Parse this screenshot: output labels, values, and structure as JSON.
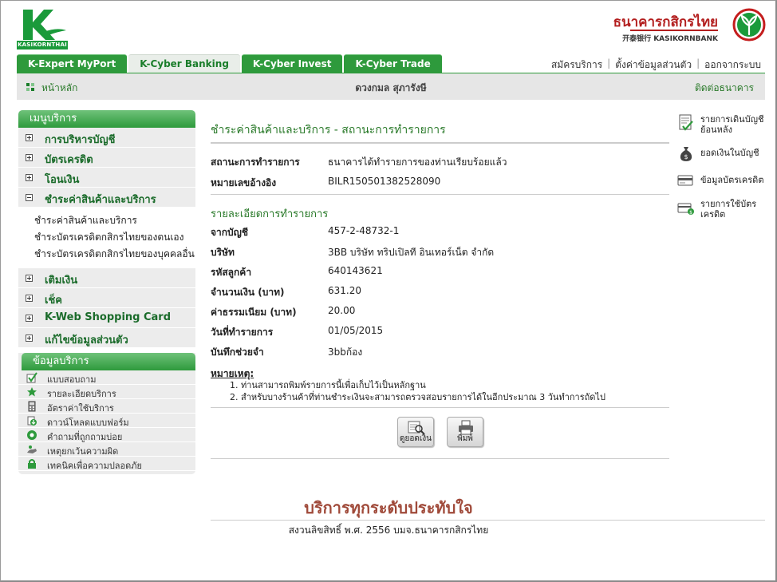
{
  "header": {
    "logo_text": "KASIKORNTHAI",
    "bank_name_th": "ธนาคารกสิกรไทย",
    "bank_name_en": "开泰银行 KASIKORNBANK"
  },
  "tabs": [
    {
      "label": "K-Expert MyPort"
    },
    {
      "label": "K-Cyber Banking"
    },
    {
      "label": "K-Cyber Invest"
    },
    {
      "label": "K-Cyber Trade"
    }
  ],
  "toplinks": [
    {
      "label": "สมัครบริการ"
    },
    {
      "label": "ตั้งค่าข้อมูลส่วนตัว"
    },
    {
      "label": "ออกจากระบบ"
    }
  ],
  "subbar": {
    "home": "หน้าหลัก",
    "user": "ดวงกมล สุภารังษี",
    "contact": "ติดต่อธนาคาร"
  },
  "menu": {
    "title": "เมนูบริการ",
    "items": [
      {
        "label": "การบริหารบัญชี"
      },
      {
        "label": "บัตรเครดิต"
      },
      {
        "label": "โอนเงิน"
      },
      {
        "label": "ชำระค่าสินค้าและบริการ"
      },
      {
        "label": "เติมเงิน"
      },
      {
        "label": "เช็ค"
      },
      {
        "label": "K-Web Shopping Card"
      },
      {
        "label": "แก้ไขข้อมูลส่วนตัว"
      }
    ],
    "sub": [
      {
        "label": "ชำระค่าสินค้าและบริการ"
      },
      {
        "label": "ชำระบัตรเครดิตกสิกรไทยของตนเอง"
      },
      {
        "label": "ชำระบัตรเครดิตกสิกรไทยของบุคคลอื่น"
      }
    ]
  },
  "info": {
    "title": "ข้อมูลบริการ",
    "items": [
      {
        "label": "แบบสอบถาม",
        "icon": "checkmark-icon"
      },
      {
        "label": "รายละเอียดบริการ",
        "icon": "star-icon"
      },
      {
        "label": "อัตราค่าใช้บริการ",
        "icon": "calculator-icon"
      },
      {
        "label": "ดาวน์โหลดแบบฟอร์ม",
        "icon": "download-icon"
      },
      {
        "label": "คำถามที่ถูกถามบ่อย",
        "icon": "faq-icon"
      },
      {
        "label": "เหตุยกเว้นความผิด",
        "icon": "hand-icon"
      },
      {
        "label": "เทคนิคเพื่อความปลอดภัย",
        "icon": "lock-icon"
      }
    ]
  },
  "content": {
    "title": "ชำระค่าสินค้าและบริการ - สถานะการทำรายการ",
    "status_label": "สถานะการทำรายการ",
    "status_value": "ธนาคารได้ทำรายการของท่านเรียบร้อยแล้ว",
    "ref_label": "หมายเลขอ้างอิง",
    "ref_value": "BILR150501382528090",
    "details_title": "รายละเอียดการทำรายการ",
    "details": [
      {
        "label": "จากบัญชี",
        "value": "457-2-48732-1"
      },
      {
        "label": "บริษัท",
        "value": "3BB บริษัท ทริปเปิลที อินเทอร์เน็ต จำกัด"
      },
      {
        "label": "รหัสลูกค้า",
        "value": "640143621"
      },
      {
        "label": "จำนวนเงิน (บาท)",
        "value": "631.20"
      },
      {
        "label": "ค่าธรรมเนียม (บาท)",
        "value": "20.00"
      },
      {
        "label": "วันที่ทำรายการ",
        "value": "01/05/2015"
      },
      {
        "label": "บันทึกช่วยจำ",
        "value": "3bbก้อง"
      }
    ],
    "remark_title": "หมายเหตุ:",
    "remarks": [
      "1. ท่านสามารถพิมพ์รายการนี้เพื่อเก็บไว้เป็นหลักฐาน",
      "2. สำหรับบางร้านค้าที่ท่านชำระเงินจะสามารถตรวจสอบรายการได้ในอีกประมาณ 3 วันทำการถัดไป"
    ],
    "btn_balance": "ดูยอดเงิน",
    "btn_print": "พิมพ์"
  },
  "quicklinks": [
    {
      "label": "รายการเดินบัญชีย้อนหลัง",
      "icon": "statement-icon"
    },
    {
      "label": "ยอดเงินในบัญชี",
      "icon": "money-bag-icon"
    },
    {
      "label": "ข้อมูลบัตรเครดิต",
      "icon": "credit-card-icon"
    },
    {
      "label": "รายการใช้บัตรเครดิต",
      "icon": "card-usage-icon"
    }
  ],
  "footer": {
    "slogan": "บริการทุกระดับประทับใจ",
    "copyright": "สงวนลิขสิทธิ์ พ.ศ. 2556 บมจ.ธนาคารกสิกรไทย"
  },
  "colors": {
    "brand_green": "#2e9a3c",
    "brand_red": "#b31e1e",
    "link_green": "#2a7a2a"
  }
}
